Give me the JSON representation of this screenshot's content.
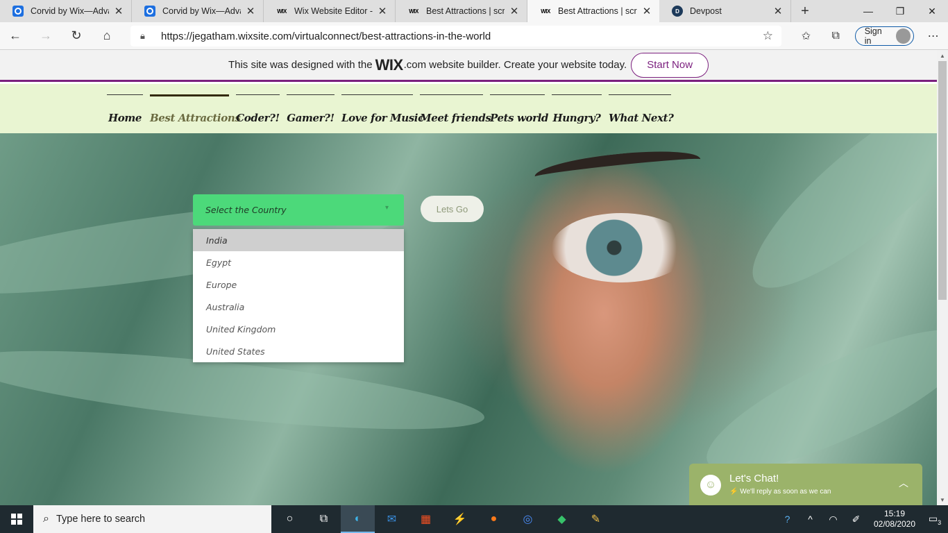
{
  "browser": {
    "tabs": [
      {
        "title": "Corvid by Wix—Advanc",
        "icon": "corvid-icon"
      },
      {
        "title": "Corvid by Wix—Advanc",
        "icon": "corvid-icon"
      },
      {
        "title": "Wix Website Editor - vir",
        "icon": "wix-icon"
      },
      {
        "title": "Best Attractions | scrum",
        "icon": "wix-icon"
      },
      {
        "title": "Best Attractions | scrum",
        "icon": "wix-icon"
      },
      {
        "title": "Devpost",
        "icon": "devpost-icon"
      }
    ],
    "favicon_text": {
      "wix": "WIX",
      "devpost": "D"
    },
    "url": "https://jegatham.wixsite.com/virtualconnect/best-attractions-in-the-world",
    "sign_in_label": "Sign in"
  },
  "wix_banner": {
    "text_before": "This site was designed with the",
    "logo": "WIX",
    "text_after": ".com website builder. Create your website today.",
    "cta": "Start Now",
    "accent": "#7b1f7e"
  },
  "site_nav": {
    "items": [
      {
        "label": "Home"
      },
      {
        "label": "Best Attractions",
        "active": true
      },
      {
        "label": "Coder?!"
      },
      {
        "label": "Gamer?!"
      },
      {
        "label": "Love for Music"
      },
      {
        "label": "Meet friends"
      },
      {
        "label": "Pets world"
      },
      {
        "label": "Hungry?"
      },
      {
        "label": "What Next?"
      }
    ],
    "background": "#e9f5d2"
  },
  "hero": {
    "country_select": {
      "placeholder": "Select the Country",
      "options": [
        "India",
        "Egypt",
        "Europe",
        "Australia",
        "United Kingdom",
        "United States"
      ],
      "highlighted": "India",
      "color": "#4cd97a"
    },
    "go_button": "Lets Go"
  },
  "chat": {
    "title": "Let's Chat!",
    "subtitle": "We'll reply as soon as we can",
    "color": "#9bb36a"
  },
  "taskbar": {
    "search_placeholder": "Type here to search",
    "time": "15:19",
    "date": "02/08/2020",
    "notification_count": "3"
  }
}
